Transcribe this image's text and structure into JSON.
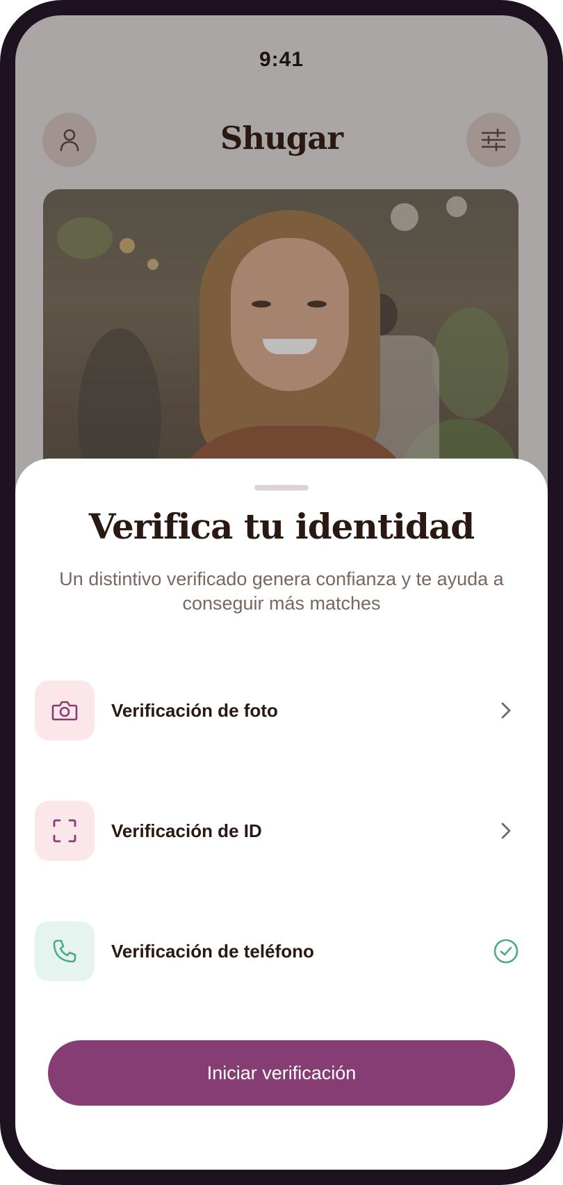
{
  "status_bar": {
    "time": "9:41"
  },
  "header": {
    "app_title": "Shugar",
    "profile_icon": "person-outline-icon",
    "filters_icon": "sliders-icon"
  },
  "profile_card": {
    "photo_description_icon": "profile-photo"
  },
  "verification_sheet": {
    "title": "Verifica tu identidad",
    "subtitle": "Un distintivo verificado genera confianza y te ayuda a conseguir más matches",
    "options": [
      {
        "label": "Verificación de foto",
        "icon": "camera-icon",
        "trailing": "chevron-right-icon",
        "status": "pending"
      },
      {
        "label": "Verificación de ID",
        "icon": "scan-frame-icon",
        "trailing": "chevron-right-icon",
        "status": "pending"
      },
      {
        "label": "Verificación de teléfono",
        "icon": "phone-icon",
        "trailing": "check-circle-icon",
        "status": "verified"
      }
    ],
    "cta_label": "Iniciar verificación"
  },
  "colors": {
    "primary": "#853d74",
    "text_dark": "#2a1812",
    "text_muted": "#7a6660",
    "pink_tile": "#fbe6ea",
    "mint_tile": "#e5f4ee",
    "success": "#4caa84",
    "chevron": "#7a6660"
  }
}
